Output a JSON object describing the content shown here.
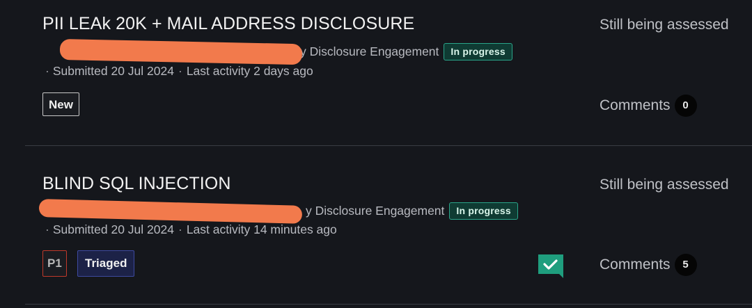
{
  "reports": [
    {
      "title": "PII LEAk 20K + MAIL ADDRESS DISCLOSURE",
      "engagement_visible": "y Disclosure Engagement",
      "status": "In progress",
      "submitted": "Submitted 20 Jul 2024",
      "last_activity": "Last activity 2 days ago",
      "tags": [
        "New"
      ],
      "assessment": "Still being assessed",
      "comments_label": "Comments",
      "comments_count": "0"
    },
    {
      "title": "BLIND SQL INJECTION",
      "engagement_visible": "y Disclosure Engagement",
      "status": "In progress",
      "submitted": "Submitted 20 Jul 2024",
      "last_activity": "Last activity 14 minutes ago",
      "tags": [
        "P1",
        "Triaged"
      ],
      "assessment": "Still being assessed",
      "comments_label": "Comments",
      "comments_count": "5"
    }
  ],
  "separator": "·",
  "icons": {
    "chat_check": "chat-check-icon"
  },
  "colors": {
    "background": "#15171c",
    "redaction": "#f27a4c",
    "status_bg": "#0f3b33",
    "status_border": "#2aa58a",
    "p1_border": "#c0392b",
    "triaged_bg": "#1c2247",
    "chat_icon": "#1f9e7e"
  }
}
